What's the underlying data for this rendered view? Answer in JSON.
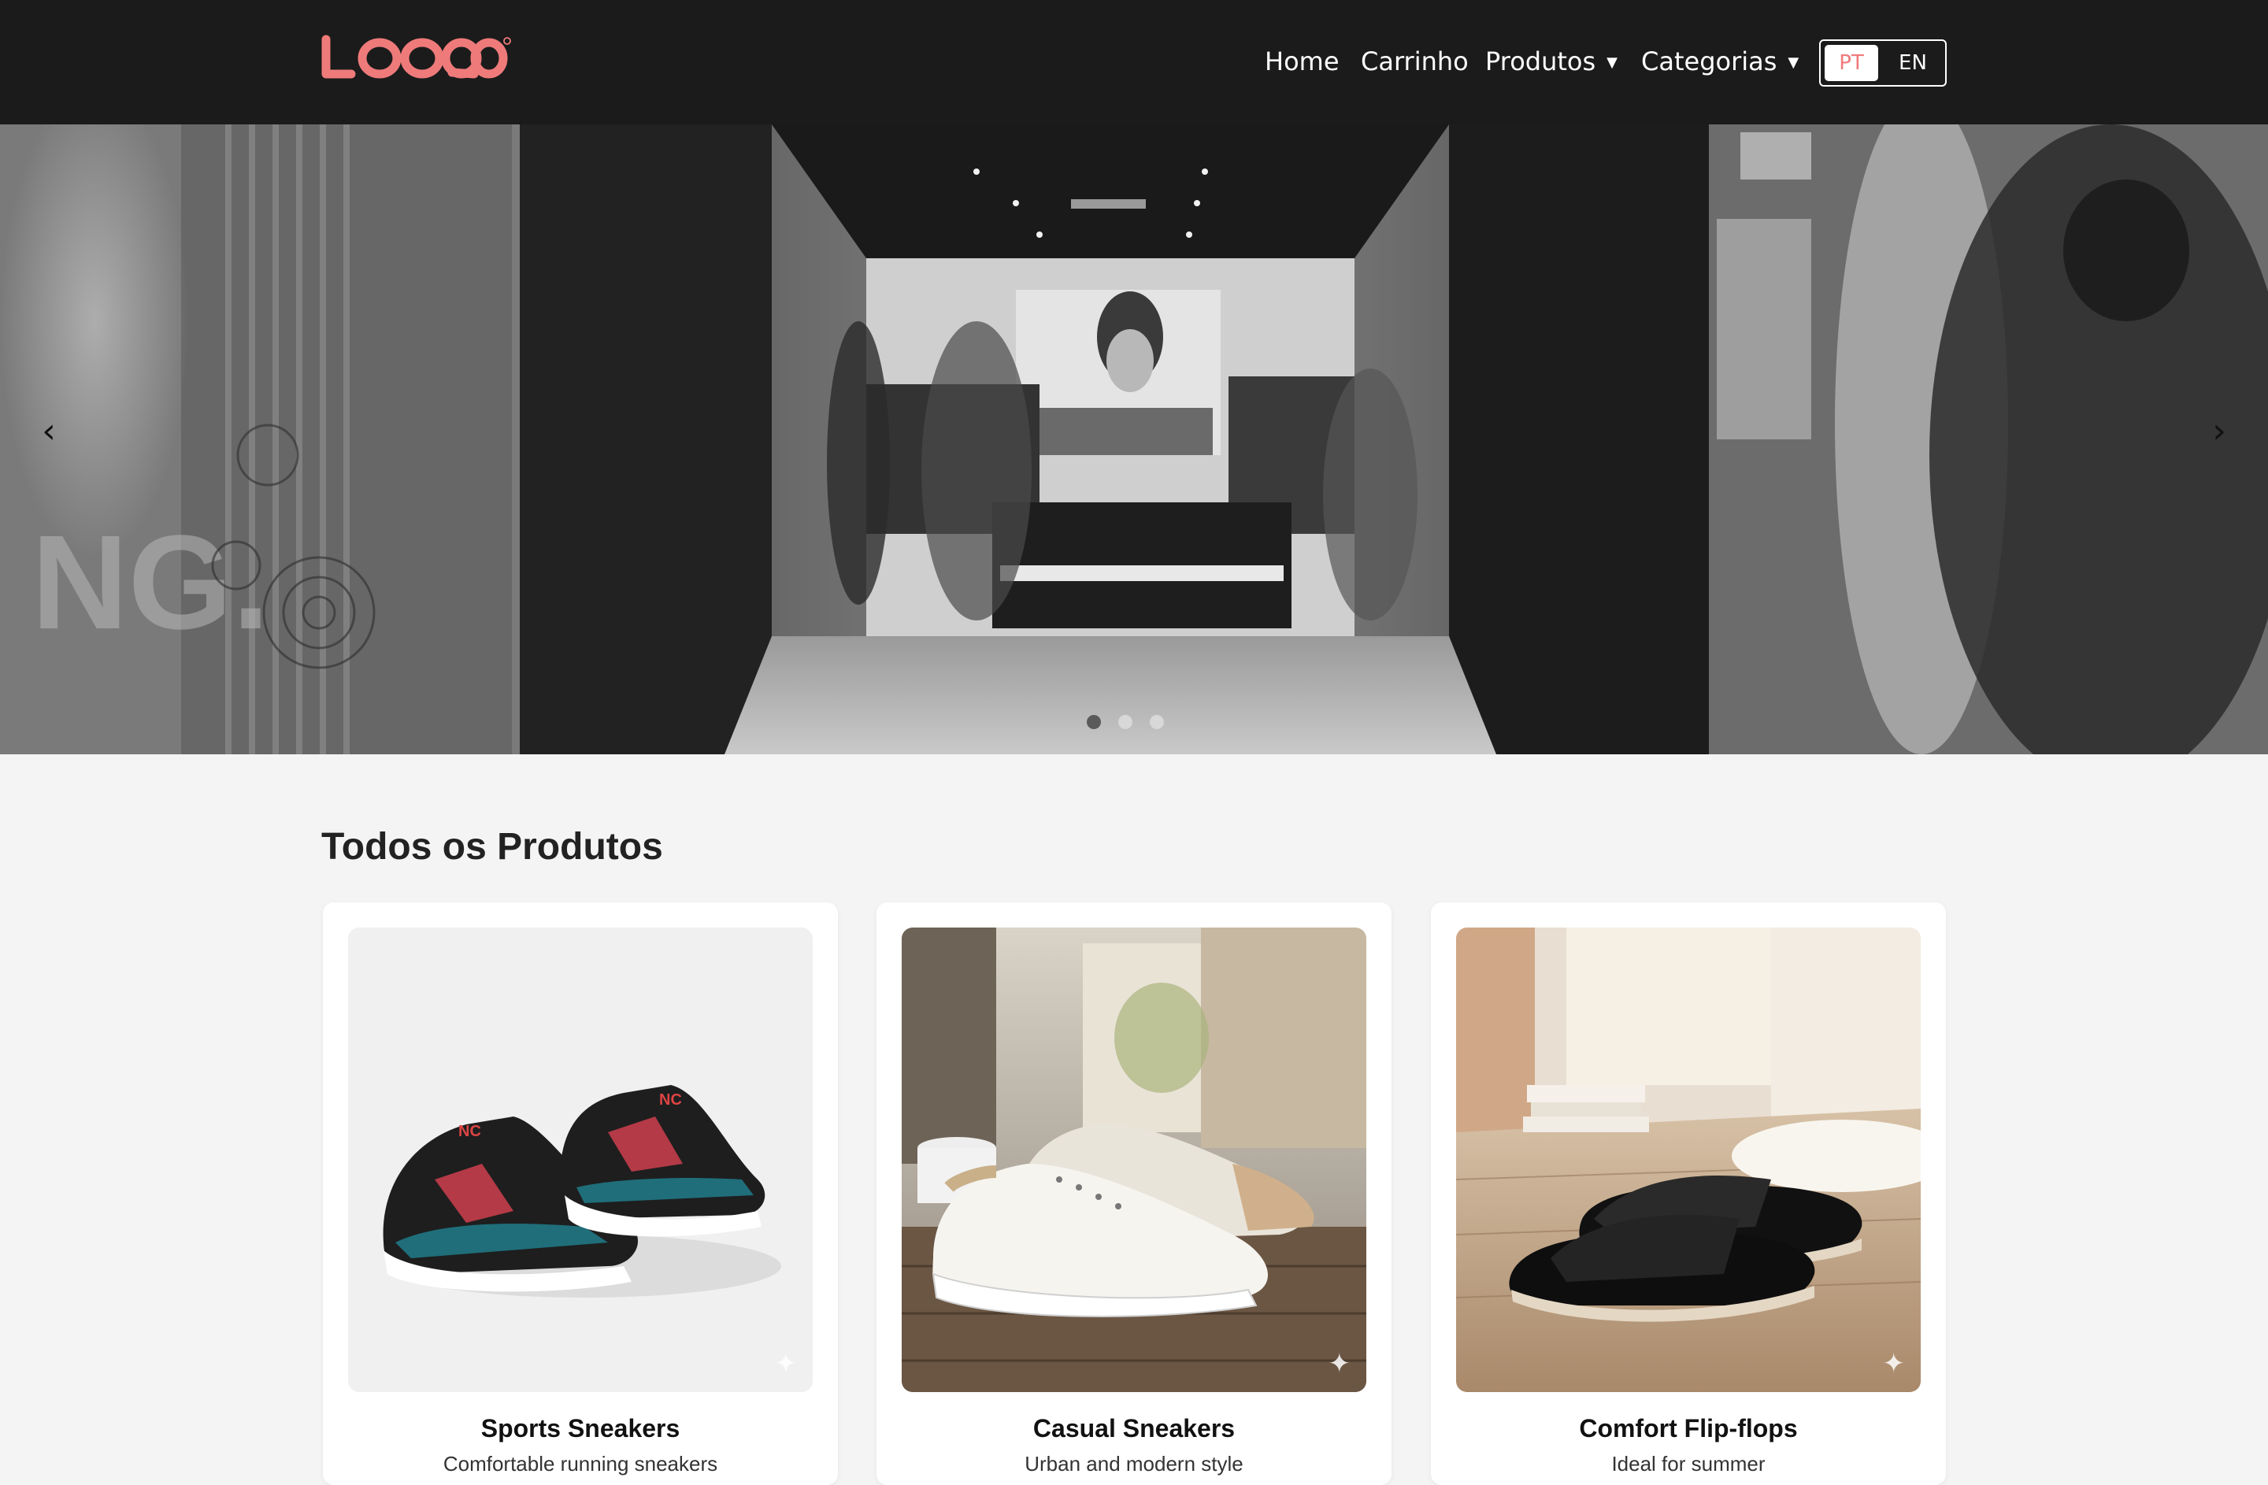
{
  "header": {
    "logo_text": "LOQO",
    "nav": [
      {
        "label": "Home"
      },
      {
        "label": "Carrinho"
      },
      {
        "label": "Produtos",
        "has_dropdown": true
      },
      {
        "label": "Categorias",
        "has_dropdown": true
      }
    ],
    "languages": [
      {
        "label": "PT",
        "active": true
      },
      {
        "label": "EN",
        "active": false
      }
    ]
  },
  "hero": {
    "prev_icon": "chevron-left-icon",
    "next_icon": "chevron-right-icon",
    "slides_count": 3,
    "active_slide": 1
  },
  "products": {
    "title": "Todos os Produtos",
    "items": [
      {
        "name": "Sports Sneakers",
        "description": "Comfortable running sneakers"
      },
      {
        "name": "Casual Sneakers",
        "description": "Urban and modern style"
      },
      {
        "name": "Comfort Flip-flops",
        "description": "Ideal for summer"
      }
    ]
  },
  "colors": {
    "header_bg": "#1b1b1b",
    "brand": "#ef7a7a",
    "page_bg": "#f4f4f4"
  }
}
